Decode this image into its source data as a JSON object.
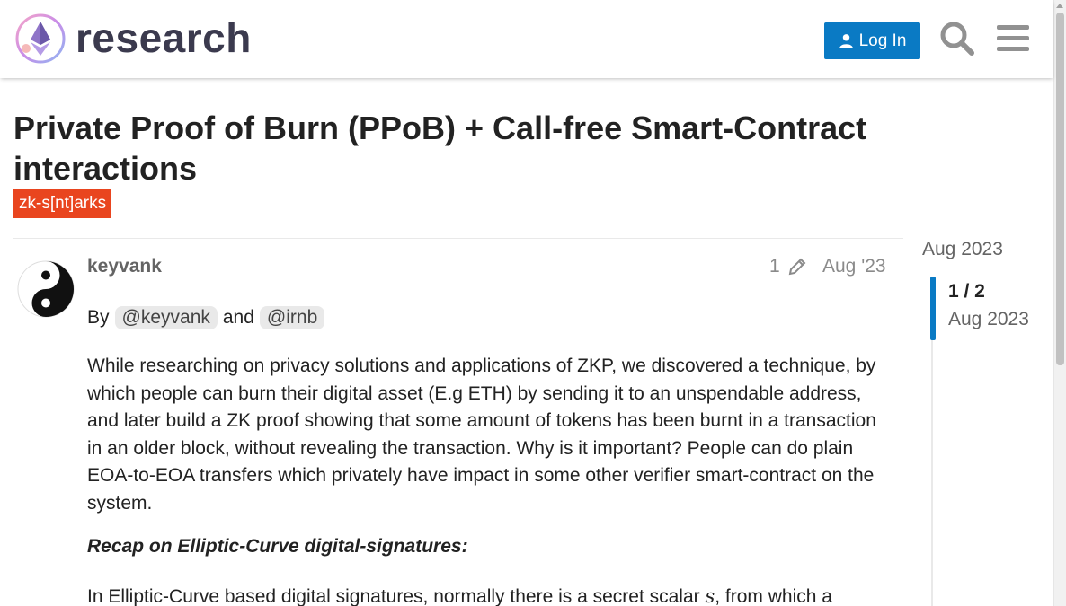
{
  "header": {
    "site_name": "research",
    "login_label": "Log In",
    "icons": [
      "ethereum-logo",
      "user-icon",
      "search-icon",
      "menu-icon"
    ]
  },
  "topic": {
    "title": "Private Proof of Burn (PPoB) + Call-free Smart-Contract interactions",
    "tag": "zk-s[nt]arks",
    "tag_color": "#e9451f"
  },
  "post": {
    "username": "keyvank",
    "edit_count": "1",
    "date": "Aug '23",
    "by_prefix": "By",
    "mention_1": "@keyvank",
    "and_word": "and",
    "mention_2": "@irnb",
    "paragraph_1": "While researching on privacy solutions and applications of ZKP, we discovered a technique, by which people can burn their digital asset (E.g ETH) by sending it to an unspendable address, and later build a ZK proof showing that some amount of tokens has been burnt in a transaction in an older block, without revealing the transaction. Why is it important? People can do plain EOA-to-EOA transfers which privately have impact in some other verifier smart-contract on the system.",
    "recap_heading": "Recap on Elliptic-Curve digital-signatures:",
    "paragraph_2_start": "In Elliptic-Curve based digital signatures, normally there is a secret scalar ",
    "paragraph_2_var": "s",
    "paragraph_2_end": ", from which a"
  },
  "timeline": {
    "start_date": "Aug 2023",
    "position": "1 / 2",
    "current_date": "Aug 2023"
  },
  "colors": {
    "accent": "#0a7ac4",
    "tag": "#e9451f"
  }
}
